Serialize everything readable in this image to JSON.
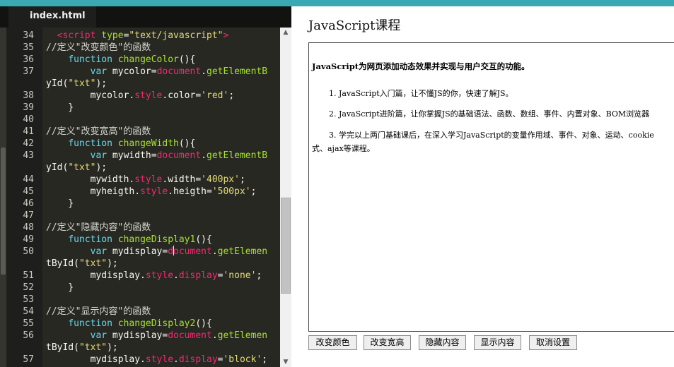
{
  "editor": {
    "tab_label": "index.html",
    "lines": [
      {
        "n": "34",
        "html": "  <span class=\"tag\">&lt;script</span> <span class=\"attr\">type</span>=<span class=\"str\">\"text/javascript\"</span><span class=\"tag\">&gt;</span>"
      },
      {
        "n": "35",
        "html": "<span class=\"cmt\">//定义\"改变颜色\"的函数</span>"
      },
      {
        "n": "36",
        "html": "    <span class=\"kw\">function</span> <span class=\"fn\">changeColor</span>(){"
      },
      {
        "n": "37",
        "html": "        <span class=\"kw\">var</span> mycolor=<span class=\"op\">document</span>.<span class=\"fn\">getElementB</span>"
      },
      {
        "n": "",
        "html": "yId(<span class=\"str\">\"txt\"</span>);"
      },
      {
        "n": "38",
        "html": "        mycolor.<span class=\"op\">style</span>.color=<span class=\"str\">'red'</span>;"
      },
      {
        "n": "39",
        "html": "    }"
      },
      {
        "n": "40",
        "html": ""
      },
      {
        "n": "41",
        "html": "<span class=\"cmt\">//定义\"改变宽高\"的函数</span>"
      },
      {
        "n": "42",
        "html": "    <span class=\"kw\">function</span> <span class=\"fn\">changeWidth</span>(){"
      },
      {
        "n": "43",
        "html": "        <span class=\"kw\">var</span> mywidth=<span class=\"op\">document</span>.<span class=\"fn\">getElementB</span>"
      },
      {
        "n": "",
        "html": "yId(<span class=\"str\">\"txt\"</span>);"
      },
      {
        "n": "44",
        "html": "        mywidth.<span class=\"op\">style</span>.width=<span class=\"str\">'400px'</span>;"
      },
      {
        "n": "45",
        "html": "        myheigth.<span class=\"op\">style</span>.heigth=<span class=\"str\">'500px'</span>;"
      },
      {
        "n": "46",
        "html": "    }"
      },
      {
        "n": "47",
        "html": ""
      },
      {
        "n": "48",
        "html": "<span class=\"cmt\">//定义\"隐藏内容\"的函数</span>"
      },
      {
        "n": "49",
        "html": "    <span class=\"kw\">function</span> <span class=\"fn\">changeDisplay1</span>(){"
      },
      {
        "n": "50",
        "html": "        <span class=\"kw\">var</span> mydisplay=<span class=\"op\">d<span class=\"caret\"></span>ocument</span>.<span class=\"fn\">getElemen</span>"
      },
      {
        "n": "",
        "html": "tById(<span class=\"str\">\"txt\"</span>);"
      },
      {
        "n": "51",
        "html": "        mydisplay.<span class=\"op\">style</span>.<span class=\"op\">display</span>=<span class=\"str\">'none'</span>;"
      },
      {
        "n": "52",
        "html": "    }"
      },
      {
        "n": "53",
        "html": ""
      },
      {
        "n": "54",
        "html": "<span class=\"cmt\">//定义\"显示内容\"的函数</span>"
      },
      {
        "n": "55",
        "html": "    <span class=\"kw\">function</span> <span class=\"fn\">changeDisplay2</span>(){"
      },
      {
        "n": "56",
        "html": "        <span class=\"kw\">var</span> mydisplay=<span class=\"op\">document</span>.<span class=\"fn\">getElemen</span>"
      },
      {
        "n": "",
        "html": "tById(<span class=\"str\">\"txt\"</span>);"
      },
      {
        "n": "57",
        "html": "        mydisplay.<span class=\"op\">style</span>.<span class=\"op\">display</span>=<span class=\"str\">'block'</span>;"
      }
    ]
  },
  "preview": {
    "title": "JavaScript课程",
    "intro": "JavaScript为网页添加动态效果并实现与用户交互的功能。",
    "p1": "1. JavaScript入门篇，让不懂JS的你，快速了解JS。",
    "p2": "2. JavaScript进阶篇，让你掌握JS的基础语法、函数、数组、事件、内置对象、BOM浏览器",
    "p3a": "3. 学完以上两门基础课后，在深入学习JavaScript的变量作用域、事件、对象、运动、cookie",
    "p3b": "式、ajax等课程。",
    "buttons": {
      "change_color": "改变颜色",
      "change_size": "改变宽高",
      "hide": "隐藏内容",
      "show": "显示内容",
      "reset": "取消设置"
    }
  },
  "colors": {
    "accent_bar": "#3aa9b4",
    "editor_bg": "#272822",
    "keyword": "#66d9ef",
    "function": "#a6e22e",
    "string": "#e6db74",
    "operator": "#f92672"
  },
  "icons": {
    "scroll_up": "triangle-up",
    "scroll_down": "triangle-down"
  }
}
